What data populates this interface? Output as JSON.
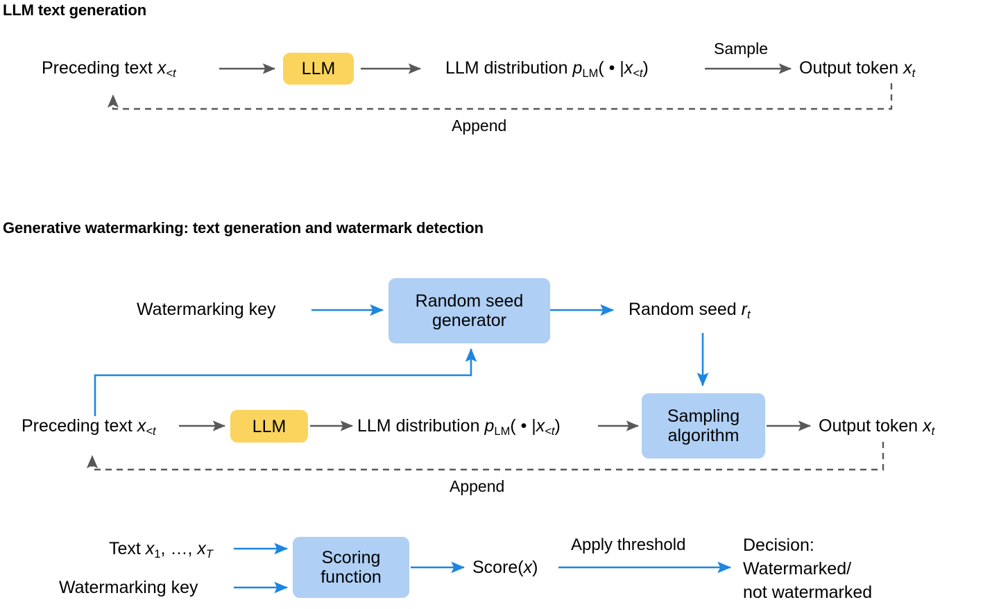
{
  "colors": {
    "yellow_box": "#FBD45E",
    "blue_box": "#AFCFF4",
    "blue_arrow": "#1C86E0",
    "gray_arrow": "#58585A",
    "dashed_arrow": "#58585A",
    "text": "#000000",
    "background": "#FFFFFF"
  },
  "sections": [
    {
      "id": "llm-text-generation",
      "title": "LLM text generation"
    },
    {
      "id": "generative-watermarking",
      "title": "Generative watermarking: text generation and watermark detection"
    }
  ],
  "diagram1": {
    "title": "LLM text generation",
    "nodes": [
      {
        "id": "llm",
        "label": "LLM",
        "style": "yellow"
      }
    ],
    "labels": {
      "preceding_text": {
        "text": "Preceding text",
        "math": "x",
        "sub": "<t"
      },
      "llm_distribution": {
        "text": "LLM distribution",
        "math": "p",
        "sub": "LM",
        "args": "( • |",
        "arg_math": "x",
        "arg_sub": "<t",
        "close": ")"
      },
      "output_token": {
        "text": "Output token",
        "math": "x",
        "sub": "t"
      },
      "sample": "Sample",
      "append": "Append"
    }
  },
  "diagram2": {
    "title": "Generative watermarking: text generation and watermark detection",
    "nodes": [
      {
        "id": "random-seed-generator",
        "label_line1": "Random seed",
        "label_line2": "generator",
        "style": "blue"
      },
      {
        "id": "llm",
        "label": "LLM",
        "style": "yellow"
      },
      {
        "id": "sampling-algorithm",
        "label_line1": "Sampling",
        "label_line2": "algorithm",
        "style": "blue"
      },
      {
        "id": "scoring-function",
        "label_line1": "Scoring",
        "label_line2": "function",
        "style": "blue"
      }
    ],
    "labels": {
      "watermarking_key_top": "Watermarking key",
      "random_seed": {
        "text": "Random seed",
        "math": "r",
        "sub": "t"
      },
      "preceding_text": {
        "text": "Preceding text",
        "math": "x",
        "sub": "<t"
      },
      "llm_distribution": {
        "text": "LLM distribution",
        "math": "p",
        "sub": "LM",
        "args": "( • |",
        "arg_math": "x",
        "arg_sub": "<t",
        "close": ")"
      },
      "output_token": {
        "text": "Output token",
        "math": "x",
        "sub": "t"
      },
      "append": "Append",
      "text_sequence": {
        "text": "Text",
        "math1": "x",
        "sub1": "1",
        "mid": ", …, ",
        "math2": "x",
        "sub2": "T"
      },
      "watermarking_key_bottom": "Watermarking key",
      "score": {
        "text": "Score(",
        "math": "x",
        "close": ")"
      },
      "apply_threshold": "Apply threshold",
      "decision_line1": "Decision:",
      "decision_line2": "Watermarked/",
      "decision_line3": "not watermarked"
    }
  }
}
